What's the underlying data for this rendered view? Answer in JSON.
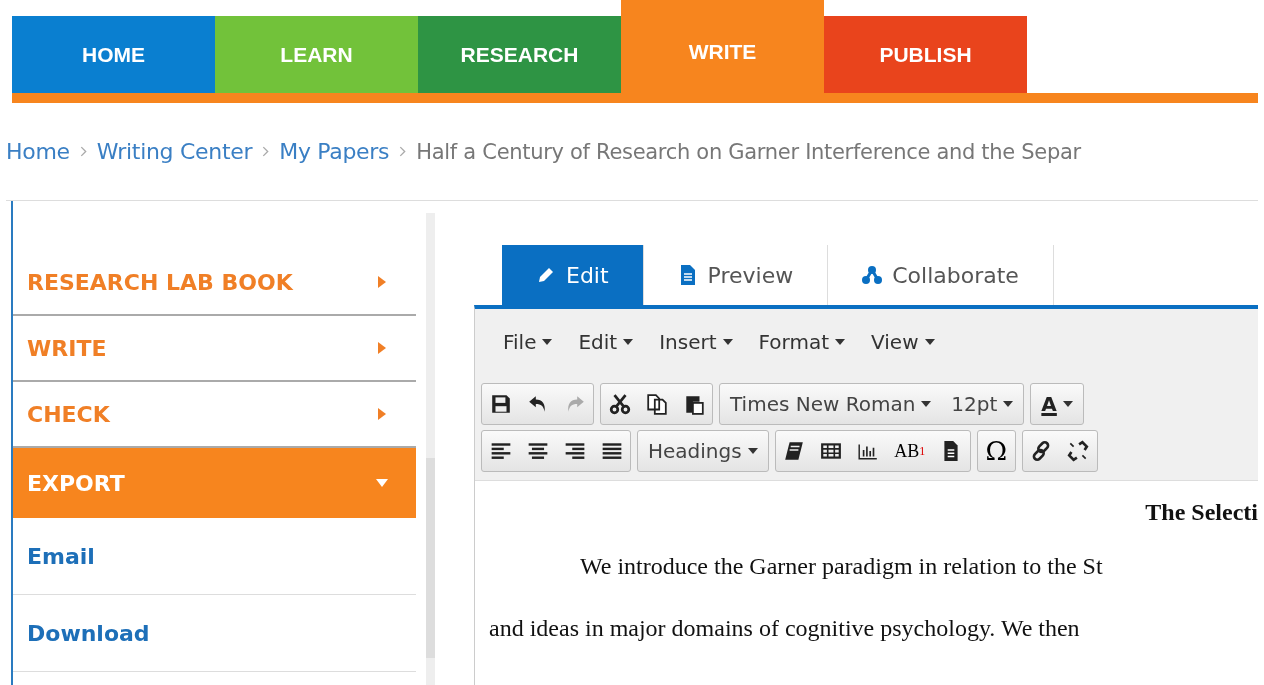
{
  "nav": [
    {
      "label": "HOME",
      "color": "#0a7fd0",
      "selected": false
    },
    {
      "label": "LEARN",
      "color": "#72c23a",
      "selected": false
    },
    {
      "label": "RESEARCH",
      "color": "#2e9444",
      "selected": false
    },
    {
      "label": "WRITE",
      "color": "#f7851e",
      "selected": true
    },
    {
      "label": "PUBLISH",
      "color": "#e9441c",
      "selected": false
    }
  ],
  "breadcrumb": [
    {
      "label": "Home",
      "link": true
    },
    {
      "label": "Writing Center",
      "link": true
    },
    {
      "label": "My Papers",
      "link": true
    },
    {
      "label": "Half a Century of Research on Garner Interference and the Separ",
      "link": false
    }
  ],
  "sidebar": {
    "items": [
      {
        "kind": "section",
        "label": "RESEARCH LAB BOOK",
        "expanded": false
      },
      {
        "kind": "section",
        "label": "WRITE",
        "expanded": false
      },
      {
        "kind": "section",
        "label": "CHECK",
        "expanded": false
      },
      {
        "kind": "section",
        "label": "EXPORT",
        "expanded": true
      },
      {
        "kind": "link",
        "label": "Email"
      },
      {
        "kind": "link",
        "label": "Download"
      }
    ]
  },
  "editor_tabs": [
    {
      "label": "Edit",
      "selected": true
    },
    {
      "label": "Preview",
      "selected": false
    },
    {
      "label": "Collaborate",
      "selected": false
    }
  ],
  "menu": [
    "File",
    "Edit",
    "Insert",
    "Format",
    "View"
  ],
  "toolbar": {
    "font": "Times New Roman",
    "size": "12pt",
    "headings": "Headings",
    "text_color_label": "A",
    "footnote_base": "AB",
    "footnote_mark": "1",
    "special_char": "Ω"
  },
  "document": {
    "title": "The Selecti",
    "lines": [
      "We introduce the Garner paradigm in relation to the St",
      "and ideas in major domains of cognitive psychology. We then"
    ]
  }
}
